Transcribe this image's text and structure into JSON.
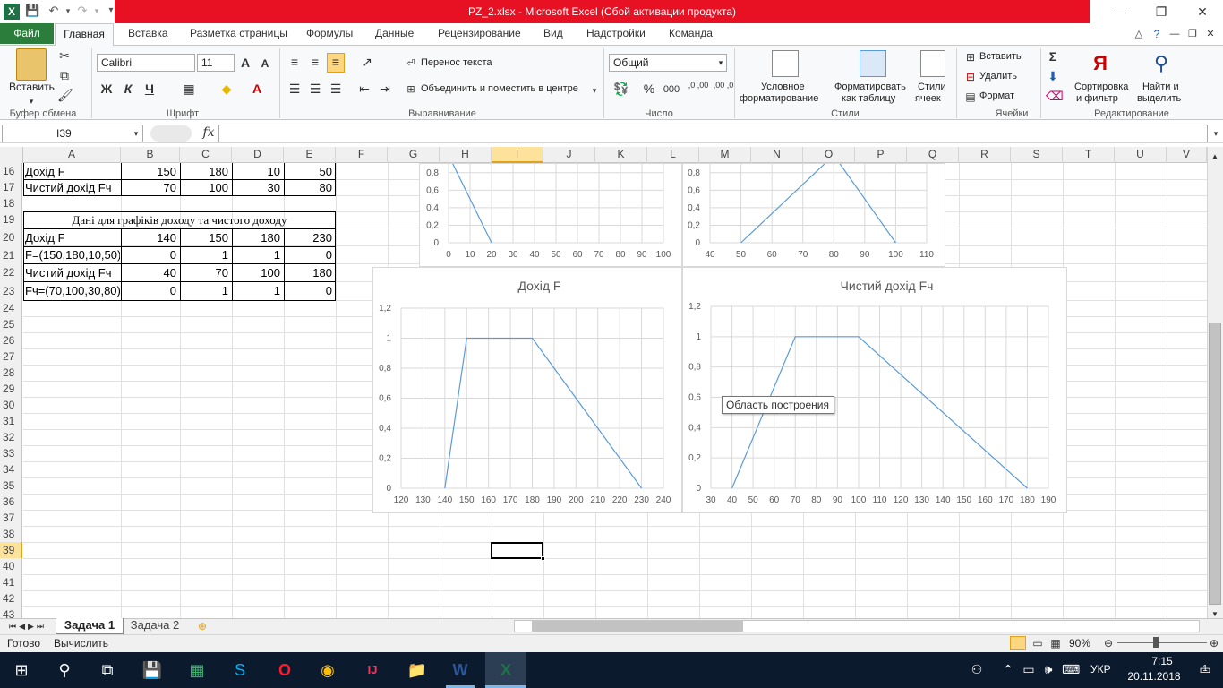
{
  "titlebar": {
    "title": "PZ_2.xlsx  -  Microsoft Excel (Сбой активации продукта)",
    "minimize": "—",
    "restore": "❐",
    "close": "✕"
  },
  "tabs": [
    "Файл",
    "Главная",
    "Вставка",
    "Разметка страницы",
    "Формулы",
    "Данные",
    "Рецензирование",
    "Вид",
    "Надстройки",
    "Команда"
  ],
  "ribbon": {
    "clipboard": {
      "paste": "Вставить",
      "label": "Буфер обмена"
    },
    "font": {
      "name": "Calibri",
      "size": "11",
      "bold": "Ж",
      "italic": "К",
      "underline": "Ч",
      "label": "Шрифт"
    },
    "alignment": {
      "wrap": "Перенос текста",
      "merge": "Объединить и поместить в центре",
      "label": "Выравнивание"
    },
    "number": {
      "format": "Общий",
      "percent": "%",
      "thousands": "000",
      "inc_decimal": ",0 ,00",
      "dec_decimal": ",00 ,0",
      "label": "Число"
    },
    "styles": {
      "conditional": [
        "Условное",
        "форматирование"
      ],
      "as_table": [
        "Форматировать",
        "как таблицу"
      ],
      "cell_styles": [
        "Стили",
        "ячеек"
      ],
      "label": "Стили"
    },
    "cells": {
      "insert": "Вставить",
      "delete": "Удалить",
      "format": "Формат",
      "label": "Ячейки"
    },
    "editing": {
      "sort": [
        "Сортировка",
        "и фильтр"
      ],
      "find": [
        "Найти и",
        "выделить"
      ],
      "label": "Редактирование"
    }
  },
  "formula_bar": {
    "name_box": "I39",
    "fx": "fx",
    "formula": ""
  },
  "columns": [
    "A",
    "B",
    "C",
    "D",
    "E",
    "F",
    "G",
    "H",
    "I",
    "J",
    "K",
    "L",
    "M",
    "N",
    "O",
    "P",
    "Q",
    "R",
    "S",
    "T",
    "U",
    "V"
  ],
  "rows": [
    "16",
    "17",
    "18",
    "19",
    "20",
    "21",
    "22",
    "23",
    "24",
    "25",
    "26",
    "27",
    "28",
    "29",
    "30",
    "31",
    "32",
    "33",
    "34",
    "35",
    "36",
    "37",
    "38",
    "39",
    "40",
    "41",
    "42",
    "43"
  ],
  "cells": {
    "r16": [
      "Дохід F",
      "150",
      "180",
      "10",
      "50"
    ],
    "r17": [
      "Чистий дохід Fч",
      "70",
      "100",
      "30",
      "80"
    ],
    "r19": "Дані для графіків доходу та чистого доходу",
    "r20": [
      "Дохід F",
      "140",
      "150",
      "180",
      "230"
    ],
    "r21": [
      "F=(150,180,10,50)",
      "0",
      "1",
      "1",
      "0"
    ],
    "r22": [
      "Чистий дохід Fч",
      "40",
      "70",
      "100",
      "180"
    ],
    "r23": [
      "Fч=(70,100,30,80)",
      "0",
      "1",
      "1",
      "0"
    ]
  },
  "chart_data": [
    {
      "type": "line",
      "title": "",
      "x": [
        0,
        20
      ],
      "series": [
        {
          "values": [
            1,
            0
          ]
        }
      ],
      "xlim": [
        0,
        100
      ],
      "xticks": [
        0,
        10,
        20,
        30,
        40,
        50,
        60,
        70,
        80,
        90,
        100
      ],
      "yticks": [
        "0",
        "0,2",
        "0,4",
        "0,6",
        "0,8"
      ],
      "ylim": [
        0,
        0.9
      ]
    },
    {
      "type": "line",
      "title": "",
      "x": [
        50,
        80,
        100
      ],
      "series": [
        {
          "values": [
            0,
            1,
            0
          ]
        }
      ],
      "xlim": [
        40,
        110
      ],
      "xticks": [
        40,
        50,
        60,
        70,
        80,
        90,
        100,
        110
      ],
      "yticks": [
        "0",
        "0,2",
        "0,4",
        "0,6",
        "0,8"
      ],
      "ylim": [
        0,
        0.9
      ]
    },
    {
      "type": "line",
      "title": "Дохід F",
      "x": [
        140,
        150,
        180,
        230
      ],
      "series": [
        {
          "values": [
            0,
            1,
            1,
            0
          ]
        }
      ],
      "xlim": [
        120,
        240
      ],
      "xticks": [
        120,
        130,
        140,
        150,
        160,
        170,
        180,
        190,
        200,
        210,
        220,
        230,
        240
      ],
      "yticks": [
        "0",
        "0,2",
        "0,4",
        "0,6",
        "0,8",
        "1",
        "1,2"
      ],
      "ylim": [
        0,
        1.2
      ]
    },
    {
      "type": "line",
      "title": "Чистий дохід Fч",
      "x": [
        40,
        70,
        100,
        180
      ],
      "series": [
        {
          "values": [
            0,
            1,
            1,
            0
          ]
        }
      ],
      "xlim": [
        30,
        190
      ],
      "xticks": [
        30,
        40,
        50,
        60,
        70,
        80,
        90,
        100,
        110,
        120,
        130,
        140,
        150,
        160,
        170,
        180,
        190
      ],
      "yticks": [
        "0",
        "0,2",
        "0,4",
        "0,6",
        "0,8",
        "1",
        "1,2"
      ],
      "ylim": [
        0,
        1.2
      ]
    }
  ],
  "tooltip": "Область построения",
  "sheets": [
    "Задача 1",
    "Задача 2"
  ],
  "status": {
    "ready": "Готово",
    "calc": "Вычислить",
    "zoom": "90%"
  },
  "tray": {
    "lang": "УКР",
    "time": "7:15",
    "date": "20.11.2018",
    "notif": "1"
  },
  "colors": {
    "accent": "#2a7d3b",
    "title_red": "#e81123",
    "series": "#5b9bd5"
  }
}
